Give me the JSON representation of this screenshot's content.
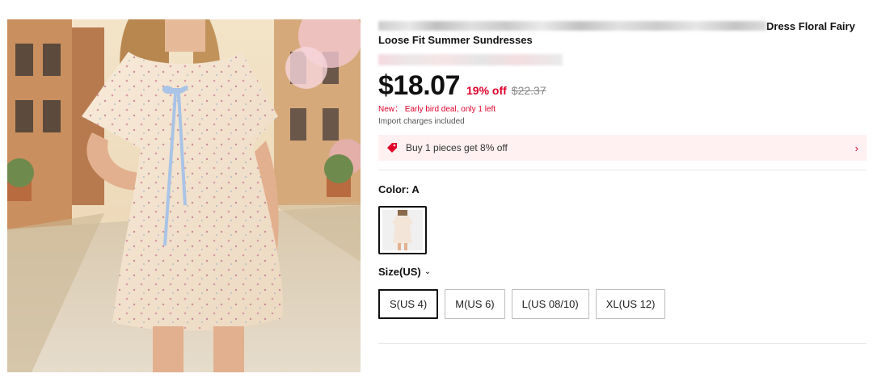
{
  "product": {
    "title_tail": "Dress Floral Fairy",
    "title_line2": "Loose Fit Summer Sundresses",
    "price": "$18.07",
    "discount": "19% off",
    "original_price": "$22.37",
    "new_notice": "New： Early bird deal, only 1 left",
    "import_notice": "Import charges included"
  },
  "promo": {
    "text": "Buy 1 pieces get 8% off",
    "icon": "price-tag-icon",
    "chevron": "›"
  },
  "color": {
    "label": "Color: A"
  },
  "size": {
    "label": "Size(US)",
    "chevron": "⌄",
    "options": [
      "S(US 4)",
      "M(US 6)",
      "L(US 08/10)",
      "XL(US 12)"
    ],
    "selected": "S(US 4)"
  },
  "colors": {
    "accent": "#e0002a",
    "promo_bg": "#fff0f1",
    "text": "#111111"
  }
}
